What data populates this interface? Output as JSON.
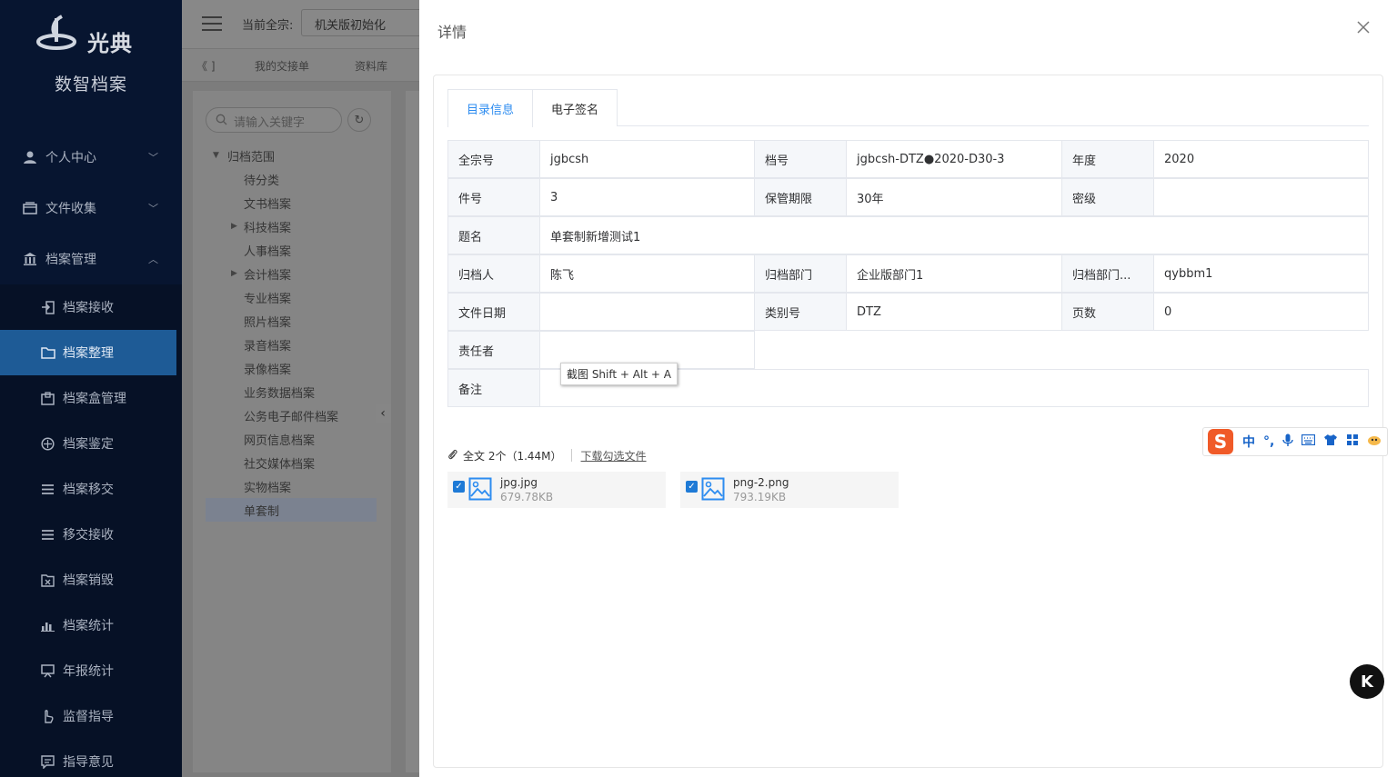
{
  "sidebar": {
    "logo_text": "光典",
    "app_name": "数智档案",
    "groups": [
      {
        "label": "个人中心",
        "icon": "user-icon"
      },
      {
        "label": "文件收集",
        "icon": "box-icon"
      },
      {
        "label": "档案管理",
        "icon": "bank-icon"
      }
    ],
    "items": [
      {
        "label": "档案接收",
        "icon": "import-icon"
      },
      {
        "label": "档案整理",
        "icon": "folder-icon"
      },
      {
        "label": "档案盒管理",
        "icon": "archive-box-icon"
      },
      {
        "label": "档案鉴定",
        "icon": "compass-icon"
      },
      {
        "label": "档案移交",
        "icon": "list-icon"
      },
      {
        "label": "移交接收",
        "icon": "list-icon"
      },
      {
        "label": "档案销毁",
        "icon": "destroy-icon"
      },
      {
        "label": "档案统计",
        "icon": "bar-chart-icon"
      },
      {
        "label": "年报统计",
        "icon": "board-icon"
      },
      {
        "label": "监督指导",
        "icon": "hand-icon"
      },
      {
        "label": "指导意见",
        "icon": "comment-icon"
      }
    ]
  },
  "header": {
    "quanzong_label": "当前全宗:",
    "quanzong_value": "机关版初始化"
  },
  "tabs_bar": [
    "《 ]",
    "我的交接单",
    "资料库"
  ],
  "tree": {
    "search_placeholder": "请输入关键字",
    "root": "归档范围",
    "children": [
      "待分类",
      "文书档案",
      "科技档案",
      "人事档案",
      "会计档案",
      "专业档案",
      "照片档案",
      "录音档案",
      "录像档案",
      "业务数据档案",
      "公务电子邮件档案",
      "网页信息档案",
      "社交媒体档案",
      "实物档案",
      "单套制"
    ]
  },
  "drawer": {
    "title": "详情",
    "tabs": [
      "目录信息",
      "电子签名"
    ],
    "fields": {
      "quanzong_label": "全宗号",
      "quanzong_value": "jgbcsh",
      "danghao_label": "档号",
      "danghao_value": "jgbcsh-DTZ●2020-D30-3",
      "niandu_label": "年度",
      "niandu_value": "2020",
      "jianhao_label": "件号",
      "jianhao_value": "3",
      "baoguan_label": "保管期限",
      "baoguan_value": "30年",
      "miji_label": "密级",
      "miji_value": "",
      "timing_label": "题名",
      "timing_value": "单套制新增测试1",
      "guidangren_label": "归档人",
      "guidangren_value": "陈飞",
      "bumen_label": "归档部门",
      "bumen_value": "企业版部门1",
      "bumen2_label": "归档部门...",
      "bumen2_value": "qybbm1",
      "riqi_label": "文件日期",
      "riqi_value": "",
      "leibie_label": "类别号",
      "leibie_value": "DTZ",
      "yeshu_label": "页数",
      "yeshu_value": "0",
      "zerenzhe_label": "责任者",
      "zerenzhe_value": "",
      "beizhu_label": "备注",
      "beizhu_value": ""
    },
    "tooltip": "截图 Shift + Alt + A",
    "attachments": {
      "summary": "全文 2个（1.44M）",
      "download_link": "下载勾选文件",
      "files": [
        {
          "name": "jpg.jpg",
          "size": "679.78KB"
        },
        {
          "name": "png-2.png",
          "size": "793.19KB"
        }
      ]
    }
  },
  "ime": {
    "mode": "中",
    "punct": "°,"
  },
  "floating_button": "K"
}
